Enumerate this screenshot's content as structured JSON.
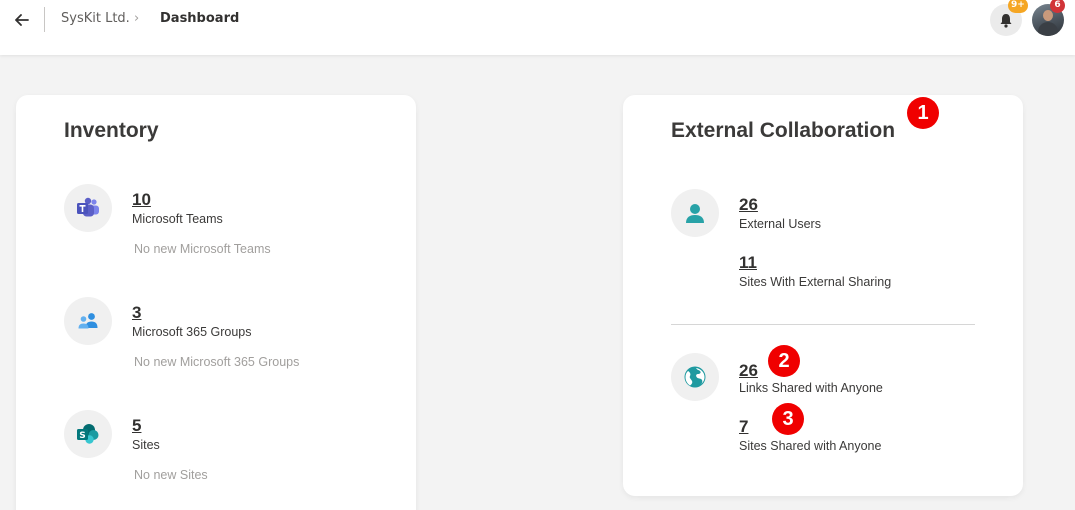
{
  "breadcrumb": {
    "org": "SysKit Ltd.",
    "separator": "›",
    "current": "Dashboard"
  },
  "header": {
    "notification_count": "9+",
    "avatar_count": "6"
  },
  "inventory": {
    "title": "Inventory",
    "items": [
      {
        "icon": "teams-icon",
        "count": "10",
        "label": "Microsoft Teams",
        "sub": "No new Microsoft Teams"
      },
      {
        "icon": "groups-icon",
        "count": "3",
        "label": "Microsoft 365 Groups",
        "sub": "No new Microsoft 365 Groups"
      },
      {
        "icon": "sharepoint-icon",
        "count": "5",
        "label": "Sites",
        "sub": "No new Sites"
      }
    ]
  },
  "external": {
    "title": "External Collaboration",
    "users": {
      "icon": "user-icon",
      "count": "26",
      "label": "External Users"
    },
    "sites_external": {
      "count": "11",
      "label": "Sites With External Sharing"
    },
    "links": {
      "icon": "globe-icon",
      "count": "26",
      "label": "Links Shared with Anyone"
    },
    "sites_anyone": {
      "count": "7",
      "label": "Sites Shared with Anyone"
    }
  },
  "markers": [
    "1",
    "2",
    "3"
  ],
  "colors": {
    "teams": "#5b5fc7",
    "groups": "#2f8fe0",
    "sharepoint": "#038387",
    "user": "#28a2a7",
    "globe": "#1f9aa0",
    "marker": "#f00000"
  }
}
